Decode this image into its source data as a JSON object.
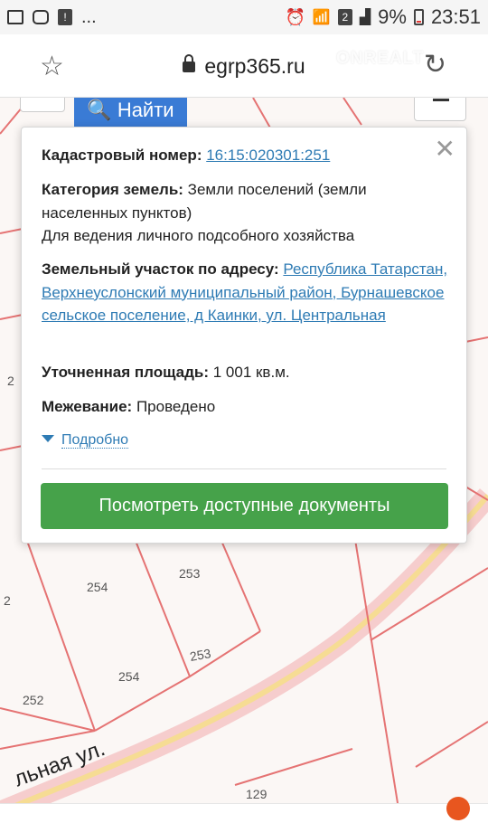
{
  "status_bar": {
    "battery": "9%",
    "time": "23:51",
    "notification_badge": "2",
    "dots": "..."
  },
  "browser": {
    "url": "egrp365.ru",
    "watermark": "ONREALT"
  },
  "map": {
    "search_label": "Найти",
    "labels": [
      "2",
      "254",
      "253",
      "253",
      "254",
      "2",
      "252",
      "129"
    ],
    "street_label": "льная ул."
  },
  "popup": {
    "cadastral_label": "Кадастровый номер:",
    "cadastral_value": "16:15:020301:251",
    "category_label": "Категория земель:",
    "category_value": "Земли поселений (земли населенных пунктов)",
    "usage": "Для ведения личного подсобного хозяйства",
    "address_label": "Земельный участок по адресу:",
    "address_value": "Республика Татарстан, Верхнеуслонский муниципальный район, Бурнашевское сельское поселение, д Каинки, ул. Центральная",
    "area_label": "Уточненная площадь:",
    "area_value": "1 001 кв.м.",
    "survey_label": "Межевание:",
    "survey_value": "Проведено",
    "more_label": "Подробно",
    "docs_button": "Посмотреть доступные документы"
  },
  "colors": {
    "link": "#2e7bb4",
    "primary_button": "#46a24a",
    "search_button": "#3a7bd5",
    "parcel_lines": "#e57373",
    "road": "#f5c8c8"
  }
}
